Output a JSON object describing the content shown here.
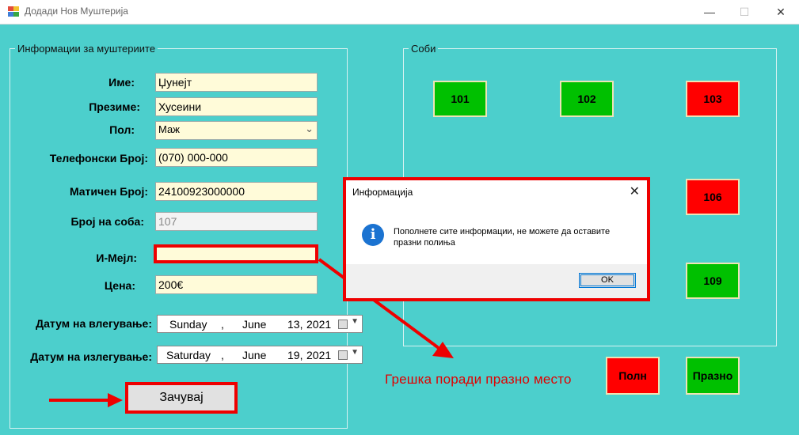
{
  "window": {
    "title": "Додади Нов Муштерија",
    "minimize": "—",
    "maximize": "☐",
    "close": "✕"
  },
  "customer_group": {
    "legend": "Информации за муштериите"
  },
  "form": {
    "name_label": "Име:",
    "name_value": "Џунејт",
    "surname_label": "Презиме:",
    "surname_value": "Хусеини",
    "gender_label": "Пол:",
    "gender_value": "Маж",
    "phone_label": "Телефонски Број:",
    "phone_value": "(070) 000-000",
    "embg_label": "Матичен Број:",
    "embg_value": "24100923000000",
    "room_label": "Број на соба:",
    "room_value": "107",
    "email_label": "И-Мејл:",
    "email_value": "",
    "price_label": "Цена:",
    "price_value": "200€",
    "checkin_label": "Датум на влегување:",
    "checkin": {
      "weekday": "Sunday",
      "month": "June",
      "day": "13,",
      "year": "2021",
      "sep": ","
    },
    "checkout_label": "Датум на излегување:",
    "checkout": {
      "weekday": "Saturday",
      "month": "June",
      "day": "19,",
      "year": "2021",
      "sep": ","
    },
    "save_label": "Зачувај"
  },
  "rooms_group": {
    "legend": "Соби",
    "rooms": [
      {
        "number": "101",
        "status": "free"
      },
      {
        "number": "102",
        "status": "free"
      },
      {
        "number": "103",
        "status": "occupied"
      },
      {
        "number": "106",
        "status": "occupied"
      },
      {
        "number": "109",
        "status": "free"
      }
    ]
  },
  "legend_buttons": {
    "full": "Полн",
    "empty": "Празно"
  },
  "annotation": {
    "error_text": "Грешка поради празно место"
  },
  "dialog": {
    "title": "Информација",
    "message": "Пополнете сите информации, не можете да оставите празни полиња",
    "ok": "OK"
  },
  "colors": {
    "background": "#4ccfcc",
    "free": "#00c000",
    "occupied": "#ff0000",
    "highlight": "#ee0000",
    "input_bg": "#fffbd9"
  }
}
